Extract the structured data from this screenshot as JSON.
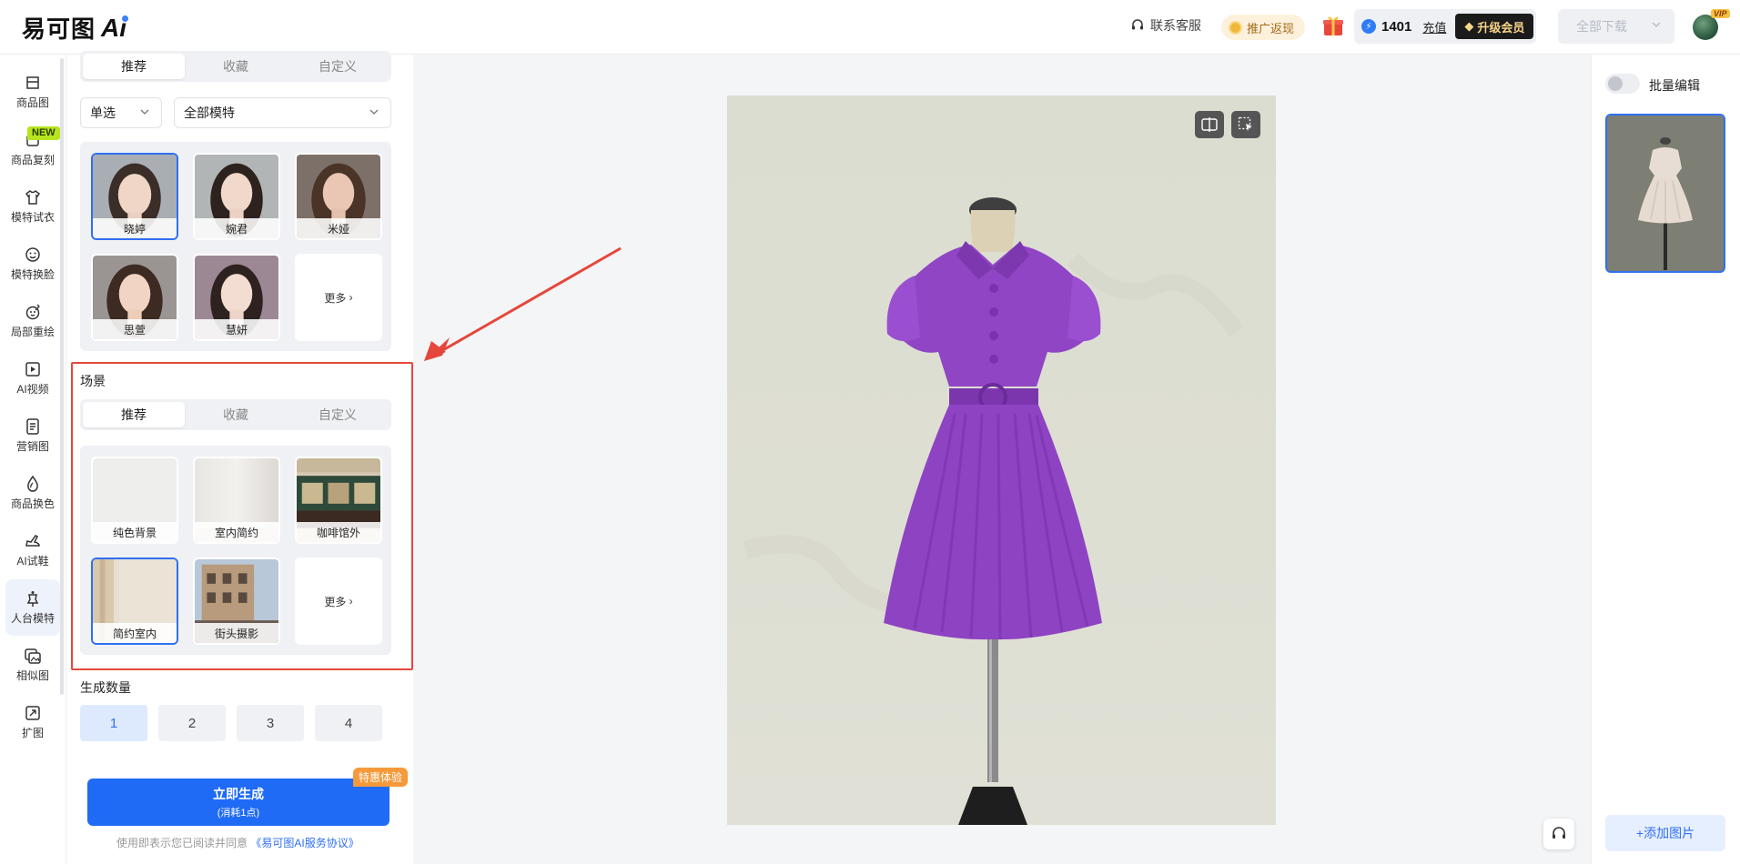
{
  "brand": {
    "name": "易可图",
    "suffix": "Ai"
  },
  "topbar": {
    "service_label": "联系客服",
    "promo_label": "推广返现",
    "credits": "1401",
    "recharge_label": "充值",
    "upgrade_label": "升级会员",
    "download_label": "全部下载",
    "vip_badge": "VIP"
  },
  "nav": {
    "new_badge": "NEW",
    "items": [
      {
        "label": "商品图",
        "icon": "image-bag-icon"
      },
      {
        "label": "商品复刻",
        "icon": "copy-bag-icon"
      },
      {
        "label": "模特试衣",
        "icon": "tshirt-icon"
      },
      {
        "label": "模特换脸",
        "icon": "face-swap-icon"
      },
      {
        "label": "局部重绘",
        "icon": "face-redraw-icon"
      },
      {
        "label": "AI视频",
        "icon": "video-icon"
      },
      {
        "label": "营销图",
        "icon": "poster-icon"
      },
      {
        "label": "商品换色",
        "icon": "color-drop-icon"
      },
      {
        "label": "AI试鞋",
        "icon": "shoe-icon"
      },
      {
        "label": "人台模特",
        "icon": "mannequin-icon"
      },
      {
        "label": "相似图",
        "icon": "similar-image-icon"
      },
      {
        "label": "扩图",
        "icon": "expand-image-icon"
      }
    ],
    "active_index": 9
  },
  "model_section": {
    "tabs": [
      "推荐",
      "收藏",
      "自定义"
    ],
    "active_tab": 0,
    "mode_select": "单选",
    "filter_select": "全部模特",
    "models": [
      {
        "name": "晓婷",
        "selected": true
      },
      {
        "name": "婉君",
        "selected": false
      },
      {
        "name": "米娅",
        "selected": false
      },
      {
        "name": "思萱",
        "selected": false
      },
      {
        "name": "慧妍",
        "selected": false
      }
    ],
    "more_label": "更多"
  },
  "scene_section": {
    "title": "场景",
    "tabs": [
      "推荐",
      "收藏",
      "自定义"
    ],
    "active_tab": 0,
    "scenes": [
      {
        "name": "纯色背景",
        "selected": false
      },
      {
        "name": "室内简约",
        "selected": false
      },
      {
        "name": "咖啡馆外",
        "selected": false
      },
      {
        "name": "简约室内",
        "selected": true
      },
      {
        "name": "街头摄影",
        "selected": false
      }
    ],
    "more_label": "更多"
  },
  "count_section": {
    "title": "生成数量",
    "options": [
      "1",
      "2",
      "3",
      "4"
    ],
    "selected": "1"
  },
  "generate": {
    "label": "立即生成",
    "cost": "(消耗1点)",
    "tag": "特惠体验",
    "agree_prefix": "使用即表示您已阅读并同意",
    "agree_link": "《易可图AI服务协议》"
  },
  "right_panel": {
    "batch_label": "批量编辑",
    "batch_enabled": false,
    "add_label": "+添加图片"
  },
  "colors": {
    "accent": "#1f6bf5",
    "highlight": "#e6473b",
    "dress": "#8f45c4"
  }
}
